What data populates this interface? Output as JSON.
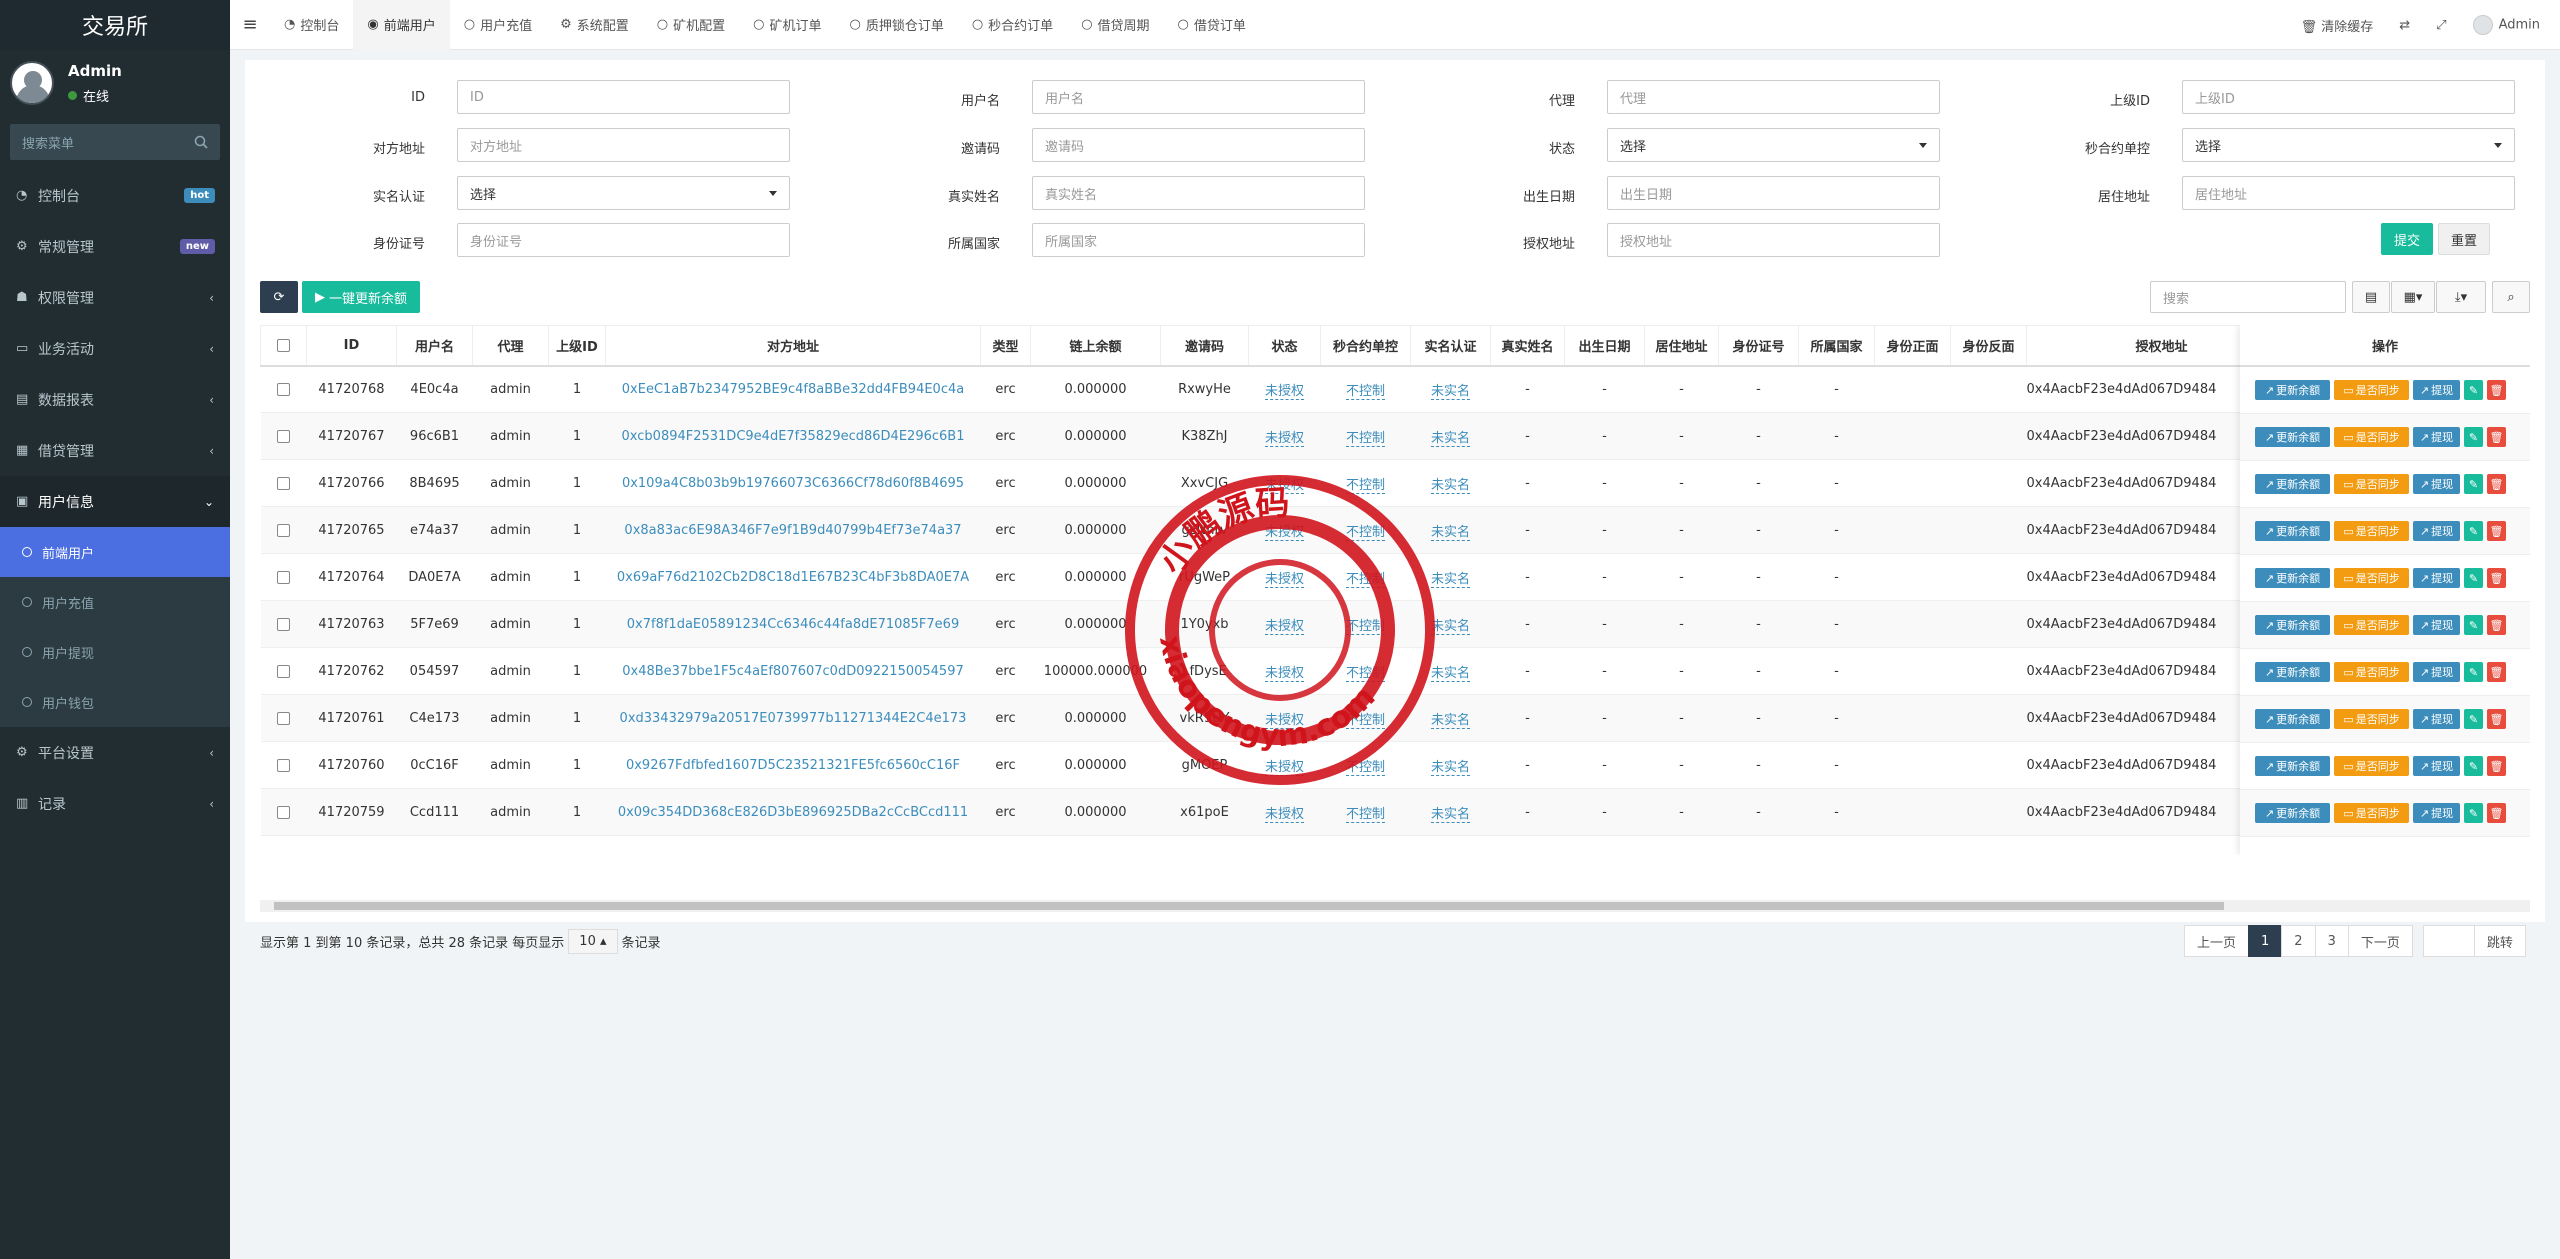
{
  "sidebar": {
    "brand": "交易所",
    "user": {
      "name": "Admin",
      "status": "在线"
    },
    "search_placeholder": "搜索菜单",
    "items": [
      {
        "label": "控制台",
        "badge": "hot",
        "icon": "dashboard-icon"
      },
      {
        "label": "常规管理",
        "badge": "new",
        "icon": "cogs-icon"
      },
      {
        "label": "权限管理",
        "icon": "group-icon"
      },
      {
        "label": "业务活动",
        "icon": "activity-icon"
      },
      {
        "label": "数据报表",
        "icon": "report-icon"
      },
      {
        "label": "借贷管理",
        "icon": "loan-icon"
      },
      {
        "label": "用户信息",
        "icon": "user-info-icon"
      }
    ],
    "submenu": [
      {
        "label": "前端用户"
      },
      {
        "label": "用户充值"
      },
      {
        "label": "用户提现"
      },
      {
        "label": "用户钱包"
      }
    ],
    "items_after": [
      {
        "label": "平台设置",
        "icon": "platform-icon"
      },
      {
        "label": "记录",
        "icon": "record-icon"
      }
    ]
  },
  "topnav": {
    "tabs": [
      "控制台",
      "前端用户",
      "用户充值",
      "系统配置",
      "矿机配置",
      "矿机订单",
      "质押锁仓订单",
      "秒合约订单",
      "借贷周期",
      "借贷订单"
    ],
    "clear_cache": "清除缓存",
    "admin": "Admin"
  },
  "form": {
    "rows": [
      [
        {
          "label": "ID",
          "placeholder": "ID"
        },
        {
          "label": "用户名",
          "placeholder": "用户名"
        },
        {
          "label": "代理",
          "placeholder": "代理"
        },
        {
          "label": "上级ID",
          "placeholder": "上级ID"
        }
      ],
      [
        {
          "label": "对方地址",
          "placeholder": "对方地址"
        },
        {
          "label": "邀请码",
          "placeholder": "邀请码"
        },
        {
          "label": "状态",
          "placeholder": "选择",
          "select": true
        },
        {
          "label": "秒合约单控",
          "placeholder": "选择",
          "select": true
        }
      ],
      [
        {
          "label": "实名认证",
          "placeholder": "选择",
          "select": true
        },
        {
          "label": "真实姓名",
          "placeholder": "真实姓名"
        },
        {
          "label": "出生日期",
          "placeholder": "出生日期"
        },
        {
          "label": "居住地址",
          "placeholder": "居住地址"
        }
      ],
      [
        {
          "label": "身份证号",
          "placeholder": "身份证号"
        },
        {
          "label": "所属国家",
          "placeholder": "所属国家"
        },
        {
          "label": "授权地址",
          "placeholder": "授权地址"
        }
      ]
    ],
    "submit": "提交",
    "reset": "重置"
  },
  "toolbar": {
    "update_all": "一键更新余额",
    "search_placeholder": "搜索"
  },
  "table": {
    "columns": [
      "ID",
      "用户名",
      "代理",
      "上级ID",
      "对方地址",
      "类型",
      "链上余额",
      "邀请码",
      "状态",
      "秒合约单控",
      "实名认证",
      "真实姓名",
      "出生日期",
      "居住地址",
      "身份证号",
      "所属国家",
      "身份正面",
      "身份反面",
      "授权地址"
    ],
    "ops_header": "操作",
    "ops": {
      "update": "更新余额",
      "sync": "是否同步",
      "withdraw": "提现"
    },
    "rows": [
      {
        "id": "41720768",
        "username": "4E0c4a",
        "agent": "admin",
        "parent": "1",
        "address": "0xEeC1aB7b2347952BE9c4f8aBBe32dd4FB94E0c4a",
        "type": "erc",
        "balance": "0.000000",
        "invite": "RxwyHe",
        "status": "未授权",
        "ctrl": "不控制",
        "kyc": "未实名",
        "realname": "-",
        "birth": "-",
        "home": "-",
        "idno": "-",
        "country": "-",
        "front": "",
        "back": "",
        "auth": "0x4AacbF23e4dAd067D9484"
      },
      {
        "id": "41720767",
        "username": "96c6B1",
        "agent": "admin",
        "parent": "1",
        "address": "0xcb0894F2531DC9e4dE7f35829ecd86D4E296c6B1",
        "type": "erc",
        "balance": "0.000000",
        "invite": "K38ZhJ",
        "status": "未授权",
        "ctrl": "不控制",
        "kyc": "未实名",
        "realname": "-",
        "birth": "-",
        "home": "-",
        "idno": "-",
        "country": "-",
        "front": "",
        "back": "",
        "auth": "0x4AacbF23e4dAd067D9484"
      },
      {
        "id": "41720766",
        "username": "8B4695",
        "agent": "admin",
        "parent": "1",
        "address": "0x109a4C8b03b9b19766073C6366Cf78d60f8B4695",
        "type": "erc",
        "balance": "0.000000",
        "invite": "XxvCJG",
        "status": "未授权",
        "ctrl": "不控制",
        "kyc": "未实名",
        "realname": "-",
        "birth": "-",
        "home": "-",
        "idno": "-",
        "country": "-",
        "front": "",
        "back": "",
        "auth": "0x4AacbF23e4dAd067D9484"
      },
      {
        "id": "41720765",
        "username": "e74a37",
        "agent": "admin",
        "parent": "1",
        "address": "0x8a83ac6E98A346F7e9f1B9d40799b4Ef73e74a37",
        "type": "erc",
        "balance": "0.000000",
        "invite": "gzNnrv",
        "status": "未授权",
        "ctrl": "不控制",
        "kyc": "未实名",
        "realname": "-",
        "birth": "-",
        "home": "-",
        "idno": "-",
        "country": "-",
        "front": "",
        "back": "",
        "auth": "0x4AacbF23e4dAd067D9484"
      },
      {
        "id": "41720764",
        "username": "DA0E7A",
        "agent": "admin",
        "parent": "1",
        "address": "0x69aF76d2102Cb2D8C18d1E67B23C4bF3b8DA0E7A",
        "type": "erc",
        "balance": "0.000000",
        "invite": "rUgWeP",
        "status": "未授权",
        "ctrl": "不控制",
        "kyc": "未实名",
        "realname": "-",
        "birth": "-",
        "home": "-",
        "idno": "-",
        "country": "-",
        "front": "",
        "back": "",
        "auth": "0x4AacbF23e4dAd067D9484"
      },
      {
        "id": "41720763",
        "username": "5F7e69",
        "agent": "admin",
        "parent": "1",
        "address": "0x7f8f1daE05891234Cc6346c44fa8dE71085F7e69",
        "type": "erc",
        "balance": "0.000000",
        "invite": "1Y0yxb",
        "status": "未授权",
        "ctrl": "不控制",
        "kyc": "未实名",
        "realname": "-",
        "birth": "-",
        "home": "-",
        "idno": "-",
        "country": "-",
        "front": "",
        "back": "",
        "auth": "0x4AacbF23e4dAd067D9484"
      },
      {
        "id": "41720762",
        "username": "054597",
        "agent": "admin",
        "parent": "1",
        "address": "0x48Be37bbe1F5c4aEf807607c0dD0922150054597",
        "type": "erc",
        "balance": "100000.000000",
        "invite": "LfDysE",
        "status": "未授权",
        "ctrl": "不控制",
        "kyc": "未实名",
        "realname": "-",
        "birth": "-",
        "home": "-",
        "idno": "-",
        "country": "-",
        "front": "",
        "back": "",
        "auth": "0x4AacbF23e4dAd067D9484"
      },
      {
        "id": "41720761",
        "username": "C4e173",
        "agent": "admin",
        "parent": "1",
        "address": "0xd33432979a20517E0739977b11271344E2C4e173",
        "type": "erc",
        "balance": "0.000000",
        "invite": "vkR9UY",
        "status": "未授权",
        "ctrl": "不控制",
        "kyc": "未实名",
        "realname": "-",
        "birth": "-",
        "home": "-",
        "idno": "-",
        "country": "-",
        "front": "",
        "back": "",
        "auth": "0x4AacbF23e4dAd067D9484"
      },
      {
        "id": "41720760",
        "username": "0cC16F",
        "agent": "admin",
        "parent": "1",
        "address": "0x9267Fdfbfed1607D5C23521321FE5fc6560cC16F",
        "type": "erc",
        "balance": "0.000000",
        "invite": "gMOEP",
        "status": "未授权",
        "ctrl": "不控制",
        "kyc": "未实名",
        "realname": "-",
        "birth": "-",
        "home": "-",
        "idno": "-",
        "country": "-",
        "front": "",
        "back": "",
        "auth": "0x4AacbF23e4dAd067D9484"
      },
      {
        "id": "41720759",
        "username": "Ccd111",
        "agent": "admin",
        "parent": "1",
        "address": "0x09c354DD368cE826D3bE896925DBa2cCcBCcd111",
        "type": "erc",
        "balance": "0.000000",
        "invite": "x61poE",
        "status": "未授权",
        "ctrl": "不控制",
        "kyc": "未实名",
        "realname": "-",
        "birth": "-",
        "home": "-",
        "idno": "-",
        "country": "-",
        "front": "",
        "back": "",
        "auth": "0x4AacbF23e4dAd067D9484"
      }
    ]
  },
  "footer": {
    "summary_prefix": "显示第 1 到第 10 条记录，总共 28 条记录 每页显示",
    "page_size": "10",
    "summary_suffix": "条记录",
    "prev": "上一页",
    "pages": [
      "1",
      "2",
      "3"
    ],
    "next": "下一页",
    "jump": "跳转"
  },
  "watermark": {
    "top_text": "小鹏源码",
    "bottom_text": "xiaopengym.com",
    "color": "#d0141c"
  },
  "colors": {
    "sidebar_bg": "#222d32",
    "active_blue": "#4b6ee0",
    "teal": "#18bc9c",
    "link": "#3c8dbc",
    "orange": "#f39c12",
    "red": "#e74c3c"
  }
}
